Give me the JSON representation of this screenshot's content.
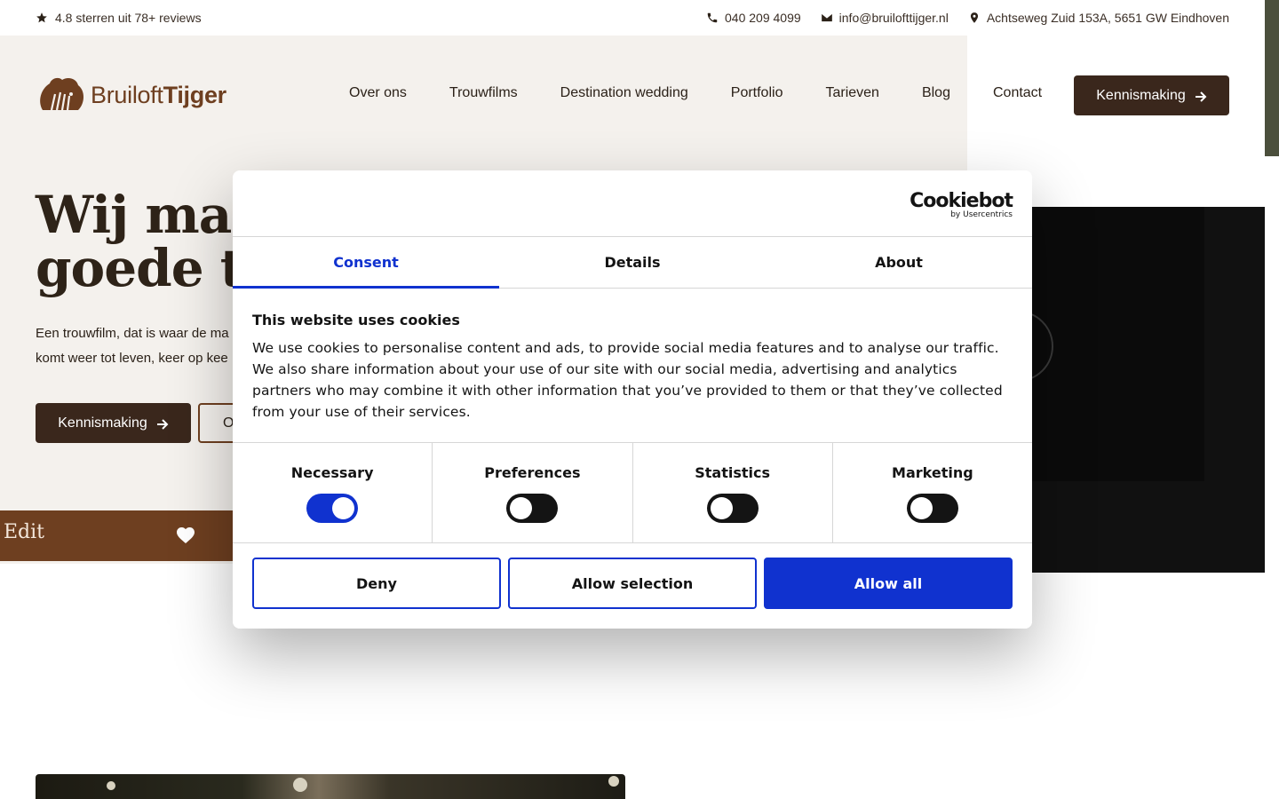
{
  "topbar": {
    "rating": "4.8 sterren uit 78+ reviews",
    "phone": "040 209 4099",
    "email": "info@bruilofttijger.nl",
    "address": "Achtseweg Zuid 153A, 5651 GW Eindhoven"
  },
  "logo": {
    "part1": "Bruiloft",
    "part2": "Tijger"
  },
  "nav": {
    "items": [
      "Over ons",
      "Trouwfilms",
      "Destination wedding",
      "Portfolio",
      "Tarieven",
      "Blog",
      "Contact"
    ],
    "cta": "Kennismaking"
  },
  "hero": {
    "title_line1": "Wij mak",
    "title_line2": "goede tr",
    "text_line1": "Een trouwfilm, dat is waar de ma",
    "text_line2": "komt weer tot leven, keer op kee",
    "btn_primary": "Kennismaking",
    "btn_outline": "O"
  },
  "ribbon": {
    "text": "Edit"
  },
  "cookie": {
    "brand": "Cookiebot",
    "brand_sub": "by Usercentrics",
    "tabs": [
      "Consent",
      "Details",
      "About"
    ],
    "title": "This website uses cookies",
    "body": "We use cookies to personalise content and ads, to provide social media features and to analyse our traffic. We also share information about your use of our site with our social media, advertising and analytics partners who may combine it with other information that you’ve provided to them or that they’ve collected from your use of their services.",
    "toggles": [
      {
        "label": "Necessary",
        "on": true
      },
      {
        "label": "Preferences",
        "on": false
      },
      {
        "label": "Statistics",
        "on": false
      },
      {
        "label": "Marketing",
        "on": false
      }
    ],
    "buttons": {
      "deny": "Deny",
      "selection": "Allow selection",
      "all": "Allow all"
    }
  },
  "colors": {
    "accent": "#1032cf",
    "brand_brown": "#6e3f20",
    "dark_brown": "#3a271c",
    "hero_bg": "#f4f1ed"
  }
}
